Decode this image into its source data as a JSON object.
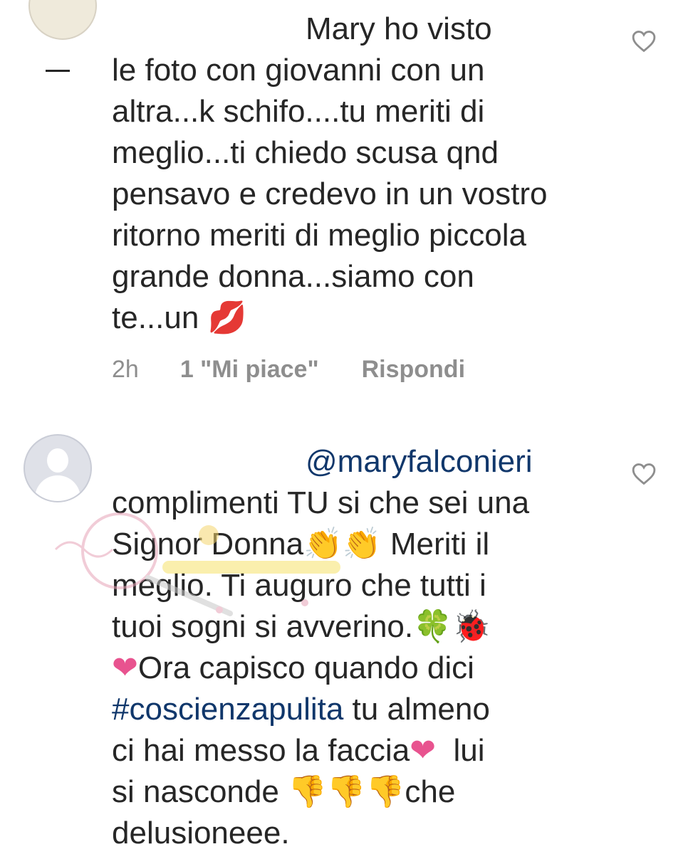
{
  "comments": [
    {
      "text_before": "Mary ho visto\nle foto con giovanni con un\naltra...k schifo....tu meriti di\nmeglio...ti chiedo scusa qnd\npensavo e credevo in un vostro\nritorno meriti di meglio piccola\ngrande donna...siamo con\nte...un ",
      "emoji_end": "💋",
      "time": "2h",
      "likes": "1 \"Mi piace\"",
      "reply": "Rispondi",
      "like_icon": "heart-outline-icon"
    },
    {
      "mention": "@maryfalconieri",
      "line2": "complimenti TU si che sei una",
      "line3a": "Signor Donna",
      "clap": "👏👏",
      "line3b": " Meriti il",
      "line4": "meglio. Ti auguro che tutti i",
      "line5": "tuoi sogni si avverino.",
      "clover_bug": "🍀🐞",
      "heart_a": "❤",
      "line6": "Ora capisco quando dici",
      "hashtag": "#coscienzapulita",
      "line7b": " tu almeno",
      "line8a": "ci hai messo la faccia",
      "heart_b": "❤",
      "line8b": "  lui",
      "line9a": "si nasconde ",
      "thumbs": "👎👎👎",
      "line9b": "che",
      "line10": "delusioneee.",
      "like_icon": "heart-outline-icon"
    }
  ],
  "colors": {
    "text": "#262626",
    "meta": "#8e8e8e",
    "link": "#10376b",
    "heart_emoji": "#e8538f"
  }
}
